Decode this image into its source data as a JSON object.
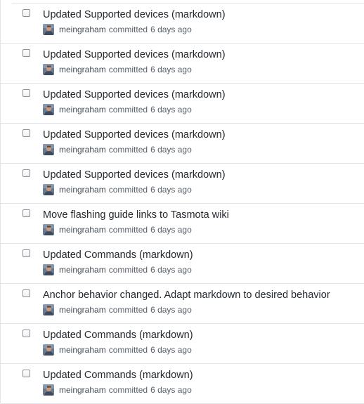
{
  "commits": [
    {
      "title": "Updated Supported devices (markdown)",
      "author": "meingraham",
      "action": "committed",
      "time": "6 days ago"
    },
    {
      "title": "Updated Supported devices (markdown)",
      "author": "meingraham",
      "action": "committed",
      "time": "6 days ago"
    },
    {
      "title": "Updated Supported devices (markdown)",
      "author": "meingraham",
      "action": "committed",
      "time": "6 days ago"
    },
    {
      "title": "Updated Supported devices (markdown)",
      "author": "meingraham",
      "action": "committed",
      "time": "6 days ago"
    },
    {
      "title": "Updated Supported devices (markdown)",
      "author": "meingraham",
      "action": "committed",
      "time": "6 days ago"
    },
    {
      "title": "Move flashing guide links to Tasmota wiki",
      "author": "meingraham",
      "action": "committed",
      "time": "6 days ago"
    },
    {
      "title": "Updated Commands (markdown)",
      "author": "meingraham",
      "action": "committed",
      "time": "6 days ago"
    },
    {
      "title": "Anchor behavior changed. Adapt markdown to desired behavior",
      "author": "meingraham",
      "action": "committed",
      "time": "6 days ago"
    },
    {
      "title": "Updated Commands (markdown)",
      "author": "meingraham",
      "action": "committed",
      "time": "6 days ago"
    },
    {
      "title": "Updated Commands (markdown)",
      "author": "meingraham",
      "action": "committed",
      "time": "6 days ago"
    }
  ],
  "colors": {
    "title": "#24292e",
    "meta": "#586069",
    "border": "#e1e4e8"
  },
  "icons": {
    "avatar": "user-avatar-icon",
    "checkbox": "checkbox-icon"
  }
}
